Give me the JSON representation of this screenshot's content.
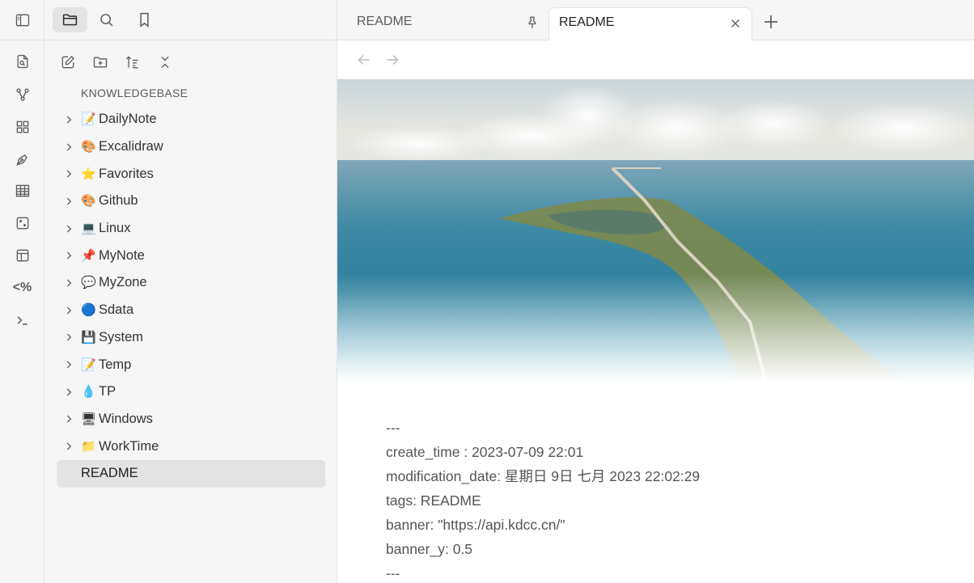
{
  "ribbon": {
    "icons": [
      "sidebar-toggle-icon",
      "file-search-icon",
      "graph-icon",
      "dashboard-icon",
      "pen-tool-icon",
      "table-icon",
      "dice-icon",
      "layout-icon",
      "template-icon",
      "terminal-icon"
    ],
    "template_label": "<%"
  },
  "sidebar": {
    "tabs": [
      "folder-icon",
      "search-icon",
      "bookmark-icon"
    ],
    "actions": [
      "new-note-icon",
      "new-folder-icon",
      "sort-icon",
      "collapse-all-icon"
    ],
    "vault_name": "KNOWLEDGEBASE",
    "folders": [
      {
        "emoji": "📝",
        "label": "DailyNote"
      },
      {
        "emoji": "🎨",
        "label": "Excalidraw"
      },
      {
        "emoji": "⭐",
        "label": "Favorites"
      },
      {
        "emoji": "🎨",
        "label": "Github"
      },
      {
        "emoji": "💻",
        "label": "Linux"
      },
      {
        "emoji": "📌",
        "label": "MyNote"
      },
      {
        "emoji": "💬",
        "label": "MyZone"
      },
      {
        "emoji": "🔵",
        "label": "Sdata"
      },
      {
        "emoji": "💾",
        "label": "System"
      },
      {
        "emoji": "📝",
        "label": "Temp"
      },
      {
        "emoji": "💧",
        "label": "TP"
      },
      {
        "emoji": "🖥",
        "label": "Windows"
      },
      {
        "emoji": "📁",
        "label": "WorkTime"
      }
    ],
    "files": [
      {
        "label": "README"
      }
    ]
  },
  "tabs": [
    {
      "label": "README",
      "icon": "pin-icon",
      "active": false
    },
    {
      "label": "README",
      "icon": "close-icon",
      "active": true
    }
  ],
  "editor": {
    "frontmatter": [
      "---",
      "create_time : 2023-07-09 22:01",
      "modification_date: 星期日 9日 七月 2023 22:02:29",
      "tags: README",
      "banner: \"https://api.kdcc.cn/\"",
      "banner_y: 0.5",
      "---"
    ]
  }
}
